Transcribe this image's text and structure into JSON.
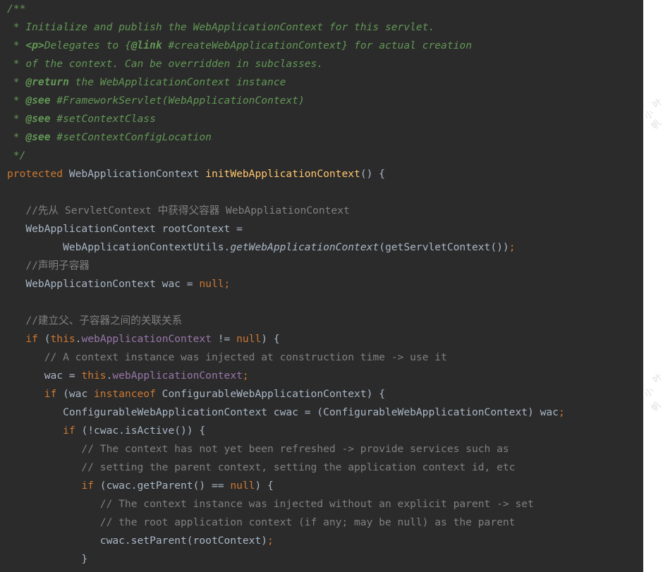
{
  "code": {
    "lines": [
      [
        {
          "t": "/**",
          "c": "doc"
        }
      ],
      [
        {
          "t": " * Initialize and publish the WebApplicationContext for this servlet.",
          "c": "doc"
        }
      ],
      [
        {
          "t": " * ",
          "c": "doc"
        },
        {
          "t": "<p>",
          "c": "doctag"
        },
        {
          "t": "Delegates to {",
          "c": "doc"
        },
        {
          "t": "@link",
          "c": "doctag"
        },
        {
          "t": " #createWebApplicationContext} for actual creation",
          "c": "doc"
        }
      ],
      [
        {
          "t": " * of the context. Can be overridden in subclasses.",
          "c": "doc"
        }
      ],
      [
        {
          "t": " * ",
          "c": "doc"
        },
        {
          "t": "@return",
          "c": "doctag"
        },
        {
          "t": " the WebApplicationContext instance",
          "c": "doc"
        }
      ],
      [
        {
          "t": " * ",
          "c": "doc"
        },
        {
          "t": "@see",
          "c": "doctag"
        },
        {
          "t": " #FrameworkServlet(WebApplicationContext)",
          "c": "doc"
        }
      ],
      [
        {
          "t": " * ",
          "c": "doc"
        },
        {
          "t": "@see",
          "c": "doctag"
        },
        {
          "t": " #setContextClass",
          "c": "doc"
        }
      ],
      [
        {
          "t": " * ",
          "c": "doc"
        },
        {
          "t": "@see",
          "c": "doctag"
        },
        {
          "t": " #setContextConfigLocation",
          "c": "doc"
        }
      ],
      [
        {
          "t": " */",
          "c": "doc"
        }
      ],
      [
        {
          "t": "protected",
          "c": "kw"
        },
        {
          "t": " WebApplicationContext ",
          "c": ""
        },
        {
          "t": "initWebApplicationContext",
          "c": "fn"
        },
        {
          "t": "() {",
          "c": ""
        }
      ],
      [],
      [
        {
          "t": "   //先从 ServletContext 中获得父容器 WebAppliationContext",
          "c": "cm"
        }
      ],
      [
        {
          "t": "   WebApplicationContext rootContext =",
          "c": ""
        }
      ],
      [
        {
          "t": "         WebApplicationContextUtils.",
          "c": ""
        },
        {
          "t": "getWebApplicationContext",
          "c": "ital"
        },
        {
          "t": "(getServletContext())",
          "c": ""
        },
        {
          "t": ";",
          "c": "kw"
        }
      ],
      [
        {
          "t": "   //声明子容器",
          "c": "cm"
        }
      ],
      [
        {
          "t": "   WebApplicationContext wac = ",
          "c": ""
        },
        {
          "t": "null;",
          "c": "kw"
        }
      ],
      [],
      [
        {
          "t": "   //建立父、子容器之间的关联关系",
          "c": "cm"
        }
      ],
      [
        {
          "t": "   ",
          "c": ""
        },
        {
          "t": "if",
          "c": "kw"
        },
        {
          "t": " (",
          "c": ""
        },
        {
          "t": "this",
          "c": "kw"
        },
        {
          "t": ".",
          "c": ""
        },
        {
          "t": "webApplicationContext",
          "c": "field"
        },
        {
          "t": " != ",
          "c": ""
        },
        {
          "t": "null",
          "c": "kw"
        },
        {
          "t": ") {",
          "c": ""
        }
      ],
      [
        {
          "t": "      // A context instance was injected at construction time -> use it",
          "c": "cm"
        }
      ],
      [
        {
          "t": "      wac = ",
          "c": ""
        },
        {
          "t": "this",
          "c": "kw"
        },
        {
          "t": ".",
          "c": ""
        },
        {
          "t": "webApplicationContext",
          "c": "field"
        },
        {
          "t": ";",
          "c": "kw"
        }
      ],
      [
        {
          "t": "      ",
          "c": ""
        },
        {
          "t": "if",
          "c": "kw"
        },
        {
          "t": " (wac ",
          "c": ""
        },
        {
          "t": "instanceof",
          "c": "kw"
        },
        {
          "t": " ConfigurableWebApplicationContext) {",
          "c": ""
        }
      ],
      [
        {
          "t": "         ConfigurableWebApplicationContext cwac = (ConfigurableWebApplicationContext) wac",
          "c": ""
        },
        {
          "t": ";",
          "c": "kw"
        }
      ],
      [
        {
          "t": "         ",
          "c": ""
        },
        {
          "t": "if",
          "c": "kw"
        },
        {
          "t": " (!cwac.isActive()) {",
          "c": ""
        }
      ],
      [
        {
          "t": "            // The context has not yet been refreshed -> provide services such as",
          "c": "cm"
        }
      ],
      [
        {
          "t": "            // setting the parent context, setting the application context id, etc",
          "c": "cm"
        }
      ],
      [
        {
          "t": "            ",
          "c": ""
        },
        {
          "t": "if",
          "c": "kw"
        },
        {
          "t": " (cwac.getParent() == ",
          "c": ""
        },
        {
          "t": "null",
          "c": "kw"
        },
        {
          "t": ") {",
          "c": ""
        }
      ],
      [
        {
          "t": "               // The context instance was injected without an explicit parent -> set",
          "c": "cm"
        }
      ],
      [
        {
          "t": "               // the root application context (if any; may be null) as the parent",
          "c": "cm"
        }
      ],
      [
        {
          "t": "               cwac.setParent(rootContext)",
          "c": ""
        },
        {
          "t": ";",
          "c": "kw"
        }
      ],
      [
        {
          "t": "            }",
          "c": ""
        }
      ]
    ]
  },
  "watermark": [
    "叶",
    "小",
    "帆",
    "叶",
    "小",
    "帆"
  ]
}
